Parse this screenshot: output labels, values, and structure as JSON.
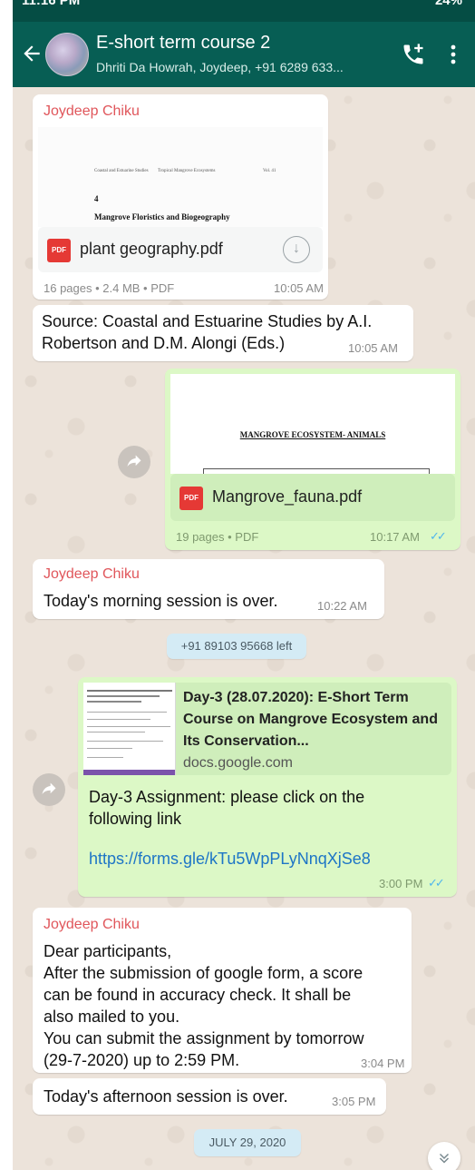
{
  "statusbar": {
    "time": "11:16 PM",
    "right": "24%"
  },
  "header": {
    "title": "E-short term course 2",
    "subtitle": "Dhriti Da Howrah, Joydeep, +91 6289 633..."
  },
  "messages": {
    "m1": {
      "sender": "Joydeep Chiku",
      "preview_line1_a": "Coastal and Estuarine Studies",
      "preview_line1_b": "Tropical Mangrove Ecosystems",
      "preview_line1_c": "Vol. 41",
      "preview_num": "4",
      "preview_heading": "Mangrove Floristics and Biogeography",
      "file_name": "plant geography.pdf",
      "meta": "16 pages • 2.4 MB • PDF",
      "time": "10:05 AM"
    },
    "m2": {
      "text1": "Source: Coastal and Estuarine Studies by A.I.",
      "text2": "Robertson and D.M. Alongi (Eds.)",
      "time": "10:05 AM"
    },
    "m3": {
      "preview_heading": "MANGROVE ECOSYSTEM- ANIMALS",
      "file_name": "Mangrove_fauna.pdf",
      "meta": "19 pages • PDF",
      "time": "10:17 AM"
    },
    "m4": {
      "sender": "Joydeep Chiku",
      "text": "Today's morning session is over.",
      "time": "10:22 AM"
    },
    "system1": "+91 89103 95668 left",
    "m5": {
      "link_title1": "Day-3 (28.07.2020): E-Short Term",
      "link_title2": "Course on Mangrove Ecosystem and",
      "link_title3": "Its Conservation...",
      "link_domain": "docs.google.com",
      "text1": "Day-3 Assignment: please click on the",
      "text2": "following link",
      "url": "https://forms.gle/kTu5WpPLyNnqXjSe8",
      "time": "3:00 PM"
    },
    "m6": {
      "sender": "Joydeep Chiku",
      "lines": [
        "Dear participants,",
        "After the submission of google form, a score",
        "can be found in accuracy check. It shall be",
        "also mailed to you.",
        "You can submit the assignment by tomorrow",
        "(29-7-2020) up to 2:59 PM."
      ],
      "time": "3:04 PM"
    },
    "m7": {
      "text": "Today's afternoon session is over.",
      "time": "3:05 PM"
    },
    "date_pill": "JULY 29, 2020"
  },
  "colors": {
    "header": "#075e54",
    "incoming": "#ffffff",
    "outgoing": "#dcf8c6",
    "sender": "#e0565b",
    "link": "#1d75c6",
    "ticks": "#4fb6ec"
  }
}
